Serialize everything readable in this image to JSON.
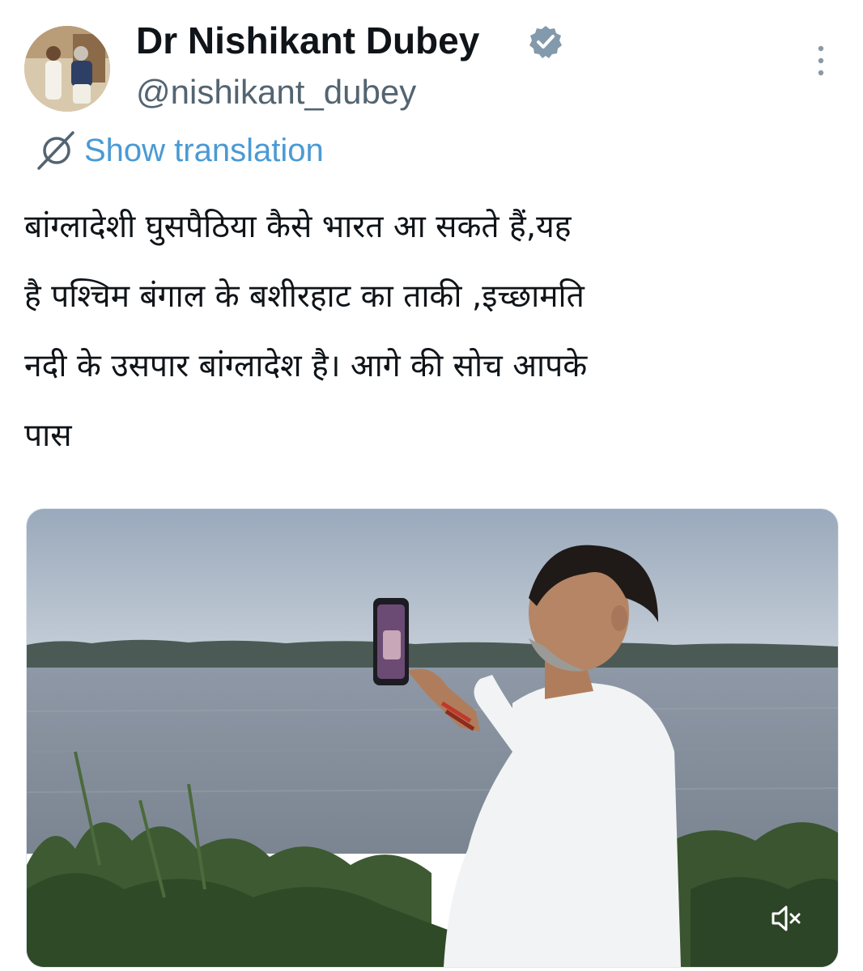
{
  "tweet": {
    "author": {
      "display_name": "Dr Nishikant Dubey",
      "handle": "@nishikant_dubey",
      "verified_badge_color": "#829aab",
      "avatar_icon": "profile-photo"
    },
    "translate_label": "Show translation",
    "text_lines": [
      "बांग्लादेशी घुसपैठिया कैसे भारत आ सकते हैं,यह",
      "है पश्चिम बंगाल के बशीरहाट का ताकी ,इच्छामति",
      "नदी के उसपार बांग्लादेश है। आगे की सोच आपके",
      "पास"
    ],
    "media": {
      "type": "video",
      "muted": true,
      "mute_icon": "speaker-muted-icon"
    },
    "more_icon": "more-vertical-icon"
  },
  "colors": {
    "text": "#0f1419",
    "secondary_text": "#536471",
    "link": "#4a9ad4"
  }
}
